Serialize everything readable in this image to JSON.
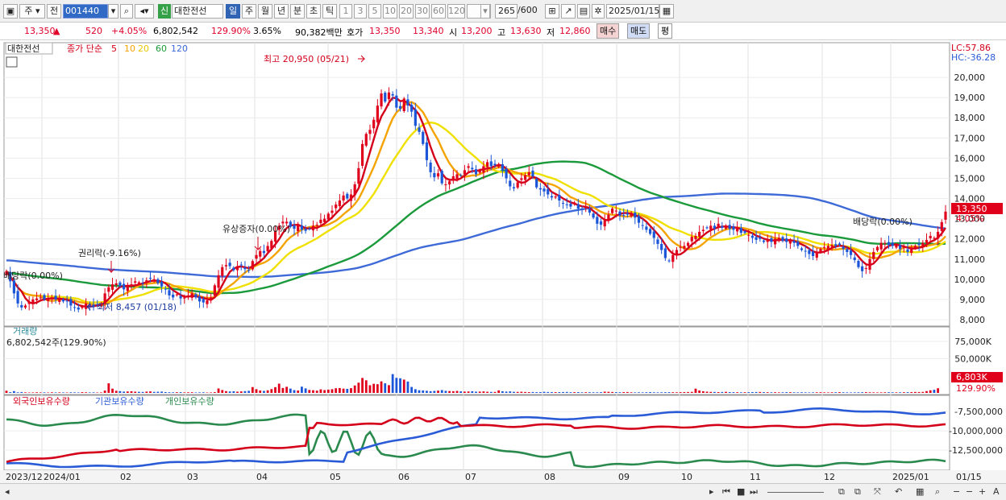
{
  "toolbar": {
    "type_label": "주",
    "type2_label": "전",
    "code": "001440",
    "name": "대한전선",
    "badge_new": "신",
    "periods": [
      "일",
      "주",
      "월",
      "년",
      "분",
      "초",
      "틱"
    ],
    "active_period": "일",
    "ticks": [
      "1",
      "3",
      "5",
      "10",
      "20",
      "30",
      "60",
      "120"
    ],
    "count": "265",
    "count_total": "/600",
    "date": "2025/01/15"
  },
  "quote": {
    "price": "13,350",
    "arrow": "▲",
    "change": "520",
    "change_pct": "+4.05%",
    "volume": "6,802,542",
    "volume_ratio": "129.90%",
    "turnover_pct": "3.65%",
    "amount": "90,382백만",
    "ask_label": "호가",
    "ask1": "13,350",
    "ask2": "13,340",
    "open_label": "시",
    "open": "13,200",
    "high_label": "고",
    "high": "13,630",
    "low_label": "저",
    "low": "12,860",
    "buy_label": "매수",
    "sell_label": "매도",
    "eval_label": "평"
  },
  "statusbar": {
    "icons": [
      "scroll-left-icon",
      "scroll-right-icon",
      "first-icon",
      "prev-icon",
      "stop-icon",
      "next-icon",
      "zoom-icon",
      "plus-icon",
      "A"
    ]
  },
  "chart_data": [
    {
      "type": "candlestick",
      "stock_label": "대한전선",
      "legend_prefix": "종가 단순",
      "ma_periods": [
        {
          "label": "5",
          "color": "#d4001a"
        },
        {
          "label": "10",
          "color": "#f5a300"
        },
        {
          "label": "20",
          "color": "#f0e000"
        },
        {
          "label": "60",
          "color": "#1a9a3a"
        },
        {
          "label": "120",
          "color": "#3e6ad8"
        }
      ],
      "yticks": [
        "20,000",
        "19,000",
        "18,000",
        "17,000",
        "16,000",
        "15,000",
        "14,000",
        "13,000",
        "12,000",
        "11,000",
        "10,000",
        "9,000",
        "8,000"
      ],
      "ylim": [
        7800,
        21200
      ],
      "x_labels": [
        "2023/12",
        "2024/01",
        "02",
        "03",
        "04",
        "05",
        "06",
        "07",
        "08",
        "09",
        "10",
        "11",
        "12",
        "2025/01",
        "01/15"
      ],
      "top_right_labels": {
        "lc": "LC:57.86",
        "hc": "HC:-36.28"
      },
      "last_price_label": "13,350",
      "last_pct_label": "4.05%",
      "annotations": [
        {
          "text": "최고 20,950 (05/21)",
          "value": 20950
        },
        {
          "text": "최저 8,457 (01/18)",
          "value": 8457
        },
        {
          "text": "권리락(-9.16%)"
        },
        {
          "text": "배당락(0.00%)"
        },
        {
          "text": "유상증자(0.00%)"
        },
        {
          "text": "배당락(0.00%)"
        }
      ],
      "closes": [
        10400,
        9900,
        9300,
        8800,
        8600,
        8700,
        8900,
        9000,
        9050,
        9100,
        9000,
        9050,
        9100,
        9000,
        9050,
        8900,
        8900,
        8700,
        8600,
        8500,
        8650,
        8800,
        8700,
        8650,
        8750,
        8800,
        9300,
        9600,
        9750,
        9800,
        9650,
        9500,
        9700,
        9750,
        9900,
        9850,
        9800,
        9950,
        10050,
        10000,
        9800,
        9650,
        9500,
        9200,
        9100,
        9250,
        9050,
        9100,
        9200,
        9300,
        9100,
        8900,
        8850,
        8950,
        9100,
        9700,
        10200,
        10600,
        10700,
        10650,
        10450,
        10650,
        10700,
        10500,
        10450,
        10900,
        11200,
        11400,
        11300,
        11650,
        11900,
        12400,
        12650,
        12850,
        12850,
        12600,
        12500,
        12700,
        12450,
        12400,
        12500,
        12650,
        12700,
        12950,
        13000,
        13250,
        13400,
        13700,
        13900,
        14150,
        14000,
        14200,
        14700,
        15500,
        16700,
        17200,
        17400,
        17900,
        18600,
        19200,
        18800,
        19250,
        19100,
        18500,
        18450,
        18950,
        18600,
        18300,
        17600,
        17300,
        16700,
        15900,
        15300,
        15050,
        15250,
        14750,
        14700,
        14850,
        15100,
        15200,
        15150,
        15400,
        15600,
        15450,
        15200,
        15400,
        15600,
        15800,
        15600,
        15650,
        15700,
        15400,
        15000,
        14600,
        14500,
        14800,
        15000,
        15150,
        15300,
        15100,
        14550,
        14450,
        14350,
        14200,
        14050,
        14100,
        13900,
        13750,
        13700,
        13600,
        13800,
        13500,
        13450,
        13600,
        13300,
        13050,
        12750,
        12700,
        12900,
        13200,
        13500,
        13400,
        13150,
        13150,
        13200,
        13300,
        13050,
        12800,
        12650,
        12450,
        12250,
        12050,
        11750,
        11450,
        11050,
        10900,
        11200,
        11450,
        11600,
        11650,
        11800,
        12100,
        12150,
        12350,
        12450,
        12550,
        12650,
        12500,
        12750,
        12550,
        12650,
        12500,
        12450,
        12550,
        12300,
        12300,
        12200,
        12050,
        11950,
        12000,
        11850,
        11950,
        11850,
        12000,
        12050,
        11900,
        11850,
        11900,
        11800,
        11650,
        11450,
        11400,
        11250,
        11150,
        11350,
        11500,
        11600,
        11650,
        11700,
        11650,
        11700,
        11500,
        11350,
        11200,
        10950,
        10600,
        10400,
        10550,
        11000,
        11350,
        11600,
        11800,
        11800,
        11700,
        11650,
        11700,
        11500,
        11600,
        11350,
        11500,
        11650,
        11700,
        11800,
        11950,
        12150,
        12050,
        12350,
        12830,
        13350
      ]
    },
    {
      "type": "bar",
      "title": "거래량",
      "value_label": "6,802,542주(129.90%)",
      "yticks": [
        "75,000K",
        "50,000K"
      ],
      "ylim": [
        0,
        95000
      ],
      "unit": "K",
      "last_label": "6,803K",
      "last_pct_label": "129.90%",
      "values": [
        3200,
        1100,
        2600,
        900,
        1300,
        800,
        600,
        700,
        900,
        700,
        800,
        600,
        900,
        700,
        800,
        700,
        600,
        900,
        800,
        700,
        1100,
        900,
        700,
        800,
        600,
        700,
        3400,
        14000,
        6200,
        3100,
        2600,
        1900,
        2100,
        2400,
        1800,
        1600,
        1400,
        1900,
        2200,
        1500,
        1700,
        1900,
        1200,
        1000,
        900,
        1000,
        1100,
        800,
        900,
        1000,
        700,
        800,
        900,
        600,
        700,
        1100,
        6500,
        4200,
        2600,
        2100,
        2400,
        1800,
        2200,
        2600,
        3000,
        8500,
        5400,
        3500,
        2900,
        3800,
        5600,
        8400,
        13500,
        7200,
        8900,
        6300,
        4100,
        3500,
        9100,
        6600,
        4300,
        3900,
        3300,
        5200,
        4100,
        4800,
        5400,
        6800,
        7100,
        6200,
        5900,
        6900,
        10800,
        14900,
        21800,
        18400,
        11200,
        13300,
        12700,
        16800,
        14000,
        11300,
        27400,
        22000,
        21300,
        19400,
        16600,
        8700,
        5400,
        3900,
        3600,
        3100,
        2500,
        2900,
        3300,
        4100,
        3000,
        2700,
        2500,
        2900,
        2300,
        1900,
        2100,
        2400,
        1800,
        1900,
        2200,
        1700,
        1500,
        1400,
        3700,
        2400,
        1900,
        2200,
        1600,
        1500,
        1700,
        1400,
        1200,
        1300,
        1100,
        1200,
        1600,
        1300,
        1200,
        1100,
        1200,
        1300,
        1400,
        1000,
        1100,
        1200,
        900,
        1000,
        1000,
        900,
        900,
        1100,
        1800,
        1600,
        1300,
        1100,
        1000,
        1200,
        1300,
        900,
        800,
        900,
        800,
        1000,
        1200,
        900,
        800,
        900,
        1000,
        1100,
        1000,
        900,
        1100,
        1200,
        1300,
        1500,
        6200,
        3500,
        2400,
        1800,
        1500,
        1400,
        1200,
        1300,
        1600,
        1200,
        1100,
        1000,
        900,
        1000,
        1100,
        1200,
        1300,
        1400,
        1100,
        1000,
        900,
        1000,
        800,
        900,
        1100,
        1000,
        900,
        800,
        900,
        800,
        700,
        800,
        900,
        1000,
        800,
        700,
        900,
        1000,
        1100,
        900,
        800,
        700,
        800,
        900,
        1000,
        1100,
        900,
        800,
        700,
        800,
        900,
        1000,
        900,
        800,
        900,
        1000,
        1100,
        1200,
        1400,
        1300,
        1500,
        2600,
        3800,
        4600,
        6800
      ]
    },
    {
      "type": "line",
      "series": [
        {
          "name": "외국인보유수량",
          "color": "#d4001a"
        },
        {
          "name": "기관보유수량",
          "color": "#2a5bd7"
        },
        {
          "name": "개인보유수량",
          "color": "#2a8a4e"
        }
      ],
      "yticks": [
        "-7,500,000",
        "-10,000,000",
        "-12,500,000"
      ],
      "ylim": [
        -15000000,
        -5500000
      ]
    }
  ]
}
